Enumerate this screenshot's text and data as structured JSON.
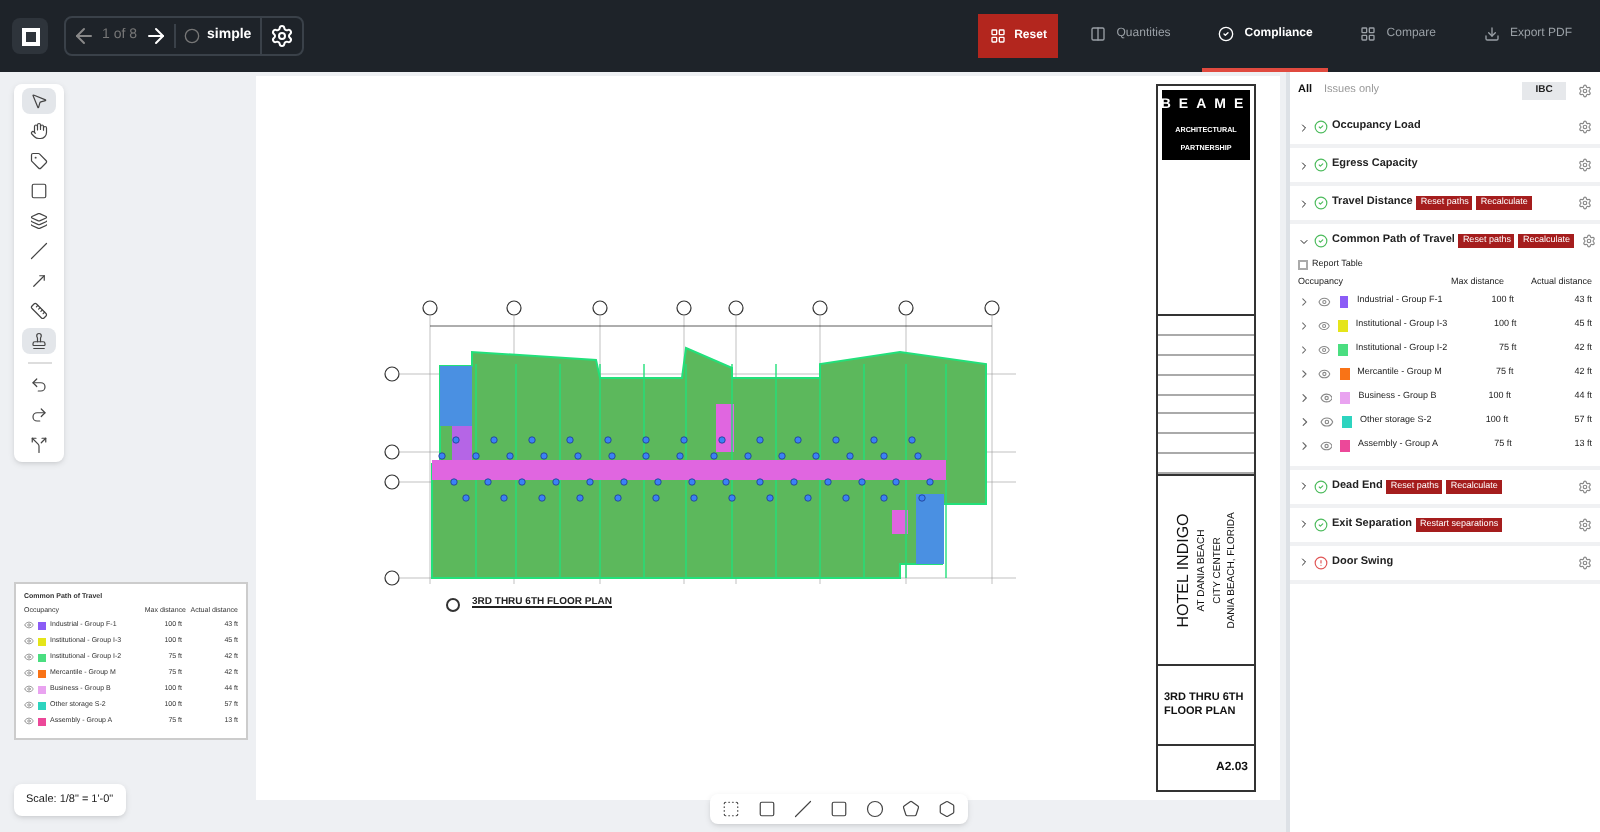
{
  "header": {
    "page_indicator": "1 of 8",
    "view": "simple",
    "reset": "Reset",
    "tabs": [
      {
        "label": "Quantities",
        "selected": false
      },
      {
        "label": "Compliance",
        "selected": true
      },
      {
        "label": "Compare",
        "selected": false
      },
      {
        "label": "Export PDF",
        "selected": false
      }
    ]
  },
  "tools": [
    {
      "selected": true
    },
    {
      "selected": false
    },
    {
      "selected": false
    },
    {
      "selected": false
    },
    {
      "selected": false
    },
    {
      "selected": false
    },
    {
      "selected": false
    },
    {
      "selected": false
    },
    {
      "selected": true
    }
  ],
  "legend": {
    "title": "Common Path of Travel",
    "columns": [
      "Occupancy",
      "Max distance",
      "Actual distance"
    ],
    "rows": [
      {
        "name": "Industrial - Group F-1",
        "color": "#8b5cf6",
        "max": "100 ft",
        "actual": "43 ft"
      },
      {
        "name": "Institutional - Group I-3",
        "color": "#e5e51a",
        "max": "100 ft",
        "actual": "45 ft"
      },
      {
        "name": "Institutional - Group I-2",
        "color": "#4ade80",
        "max": "75 ft",
        "actual": "42 ft"
      },
      {
        "name": "Mercantile - Group M",
        "color": "#f97316",
        "max": "75 ft",
        "actual": "42 ft"
      },
      {
        "name": "Business - Group B",
        "color": "#e9a3f0",
        "max": "100 ft",
        "actual": "44 ft"
      },
      {
        "name": "Other storage S-2",
        "color": "#2dd4bf",
        "max": "100 ft",
        "actual": "57 ft"
      },
      {
        "name": "Assembly - Group A",
        "color": "#ec4899",
        "max": "75 ft",
        "actual": "13 ft"
      }
    ]
  },
  "scale": "Scale: 1/8\" = 1'-0\"",
  "sheet": {
    "firm": [
      "BEAME",
      "ARCHITECTURAL",
      "PARTNERSHIP"
    ],
    "project": [
      "HOTEL INDIGO",
      "AT DANIA BEACH",
      "CITY CENTER",
      "DANIA BEACH, FLORIDA"
    ],
    "sheet_title": "3RD THRU 6TH FLOOR PLAN",
    "sheet_number": "A2.03",
    "plan_title": "3RD THRU 6TH FLOOR PLAN"
  },
  "panel": {
    "filters": [
      {
        "label": "All",
        "selected": true
      },
      {
        "label": "Issues only",
        "selected": false
      }
    ],
    "code": "IBC",
    "sections": [
      {
        "title": "Occupancy Load",
        "passed": true,
        "expanded": false
      },
      {
        "title": "Egress Capacity",
        "passed": true,
        "expanded": false
      },
      {
        "title": "Travel Distance",
        "passed": true,
        "expanded": false,
        "actions": [
          "Reset paths",
          "Recalculate"
        ]
      },
      {
        "title": "Common Path of Travel",
        "passed": true,
        "expanded": true,
        "actions": [
          "Reset paths",
          "Recalculate"
        ]
      },
      {
        "title": "Dead End",
        "passed": true,
        "expanded": false,
        "actions": [
          "Reset paths",
          "Recalculate"
        ]
      },
      {
        "title": "Exit Separation",
        "passed": true,
        "expanded": false,
        "actions": [
          "Restart separations"
        ]
      },
      {
        "title": "Door Swing",
        "passed": false,
        "expanded": false
      }
    ],
    "report_table": {
      "label": "Report Table",
      "checked": false,
      "columns": [
        "Occupancy",
        "Max distance",
        "Actual distance"
      ],
      "rows": [
        {
          "name": "Industrial - Group F-1",
          "color": "#8b5cf6",
          "max": "100 ft",
          "actual": "43 ft"
        },
        {
          "name": "Institutional - Group I-3",
          "color": "#e5e51a",
          "max": "100 ft",
          "actual": "45 ft"
        },
        {
          "name": "Institutional - Group I-2",
          "color": "#4ade80",
          "max": "75 ft",
          "actual": "42 ft"
        },
        {
          "name": "Mercantile - Group M",
          "color": "#f97316",
          "max": "75 ft",
          "actual": "42 ft"
        },
        {
          "name": "Business - Group B",
          "color": "#e9a3f0",
          "max": "100 ft",
          "actual": "44 ft"
        },
        {
          "name": "Other storage S-2",
          "color": "#2dd4bf",
          "max": "100 ft",
          "actual": "57 ft"
        },
        {
          "name": "Assembly - Group A",
          "color": "#ec4899",
          "max": "75 ft",
          "actual": "13 ft"
        }
      ]
    }
  }
}
